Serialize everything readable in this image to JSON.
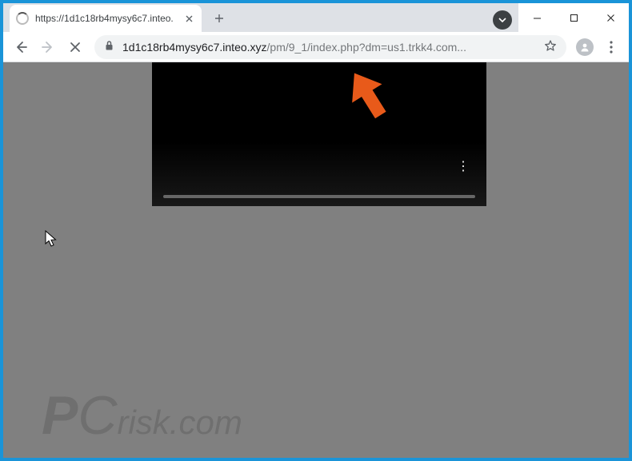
{
  "window": {
    "minimize_label": "Minimize",
    "maximize_label": "Maximize",
    "close_label": "Close"
  },
  "tab": {
    "title": "https://1d1c18rb4mysy6c7.inteo.",
    "close_label": "Close tab"
  },
  "newtab": {
    "label": "New tab"
  },
  "tabstrip": {
    "caret_label": "Search tabs"
  },
  "nav": {
    "back_label": "Back",
    "forward_label": "Forward",
    "stop_label": "Stop"
  },
  "omnibox": {
    "lock_label": "Secure",
    "domain": "1d1c18rb4mysy6c7.inteo.xyz",
    "path": "/pm/9_1/index.php?dm=us1.trkk4.com...",
    "bookmark_label": "Bookmark this page"
  },
  "profile": {
    "label": "Profile"
  },
  "menu": {
    "label": "Customize and control"
  },
  "video": {
    "more_label": "More options",
    "more_glyph": "⋮"
  },
  "watermark": {
    "p": "P",
    "c": "C",
    "suffix": "risk.com"
  },
  "colors": {
    "frame": "#1a94d8",
    "content_bg": "#808080",
    "arrow": "#e85a1a"
  }
}
